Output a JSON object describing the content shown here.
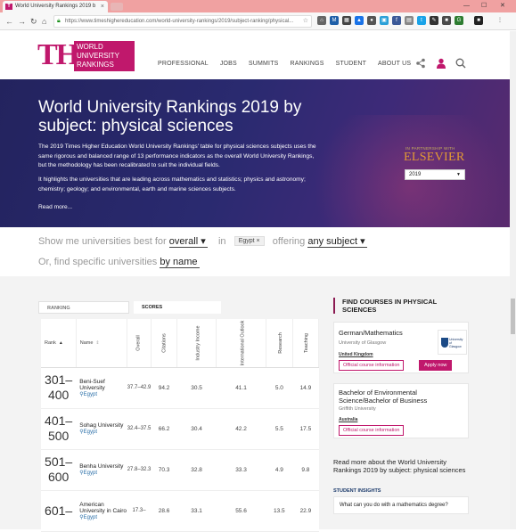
{
  "browser": {
    "tab_title": "World University Rankings 2019 b",
    "tab_close": "×",
    "url": "https://www.timeshighereducation.com/world-university-rankings/2019/subject-ranking/physical...",
    "minimize": "—",
    "maximize": "☐",
    "close": "✕"
  },
  "header": {
    "logo_the": "THE",
    "logo_line1": "WORLD",
    "logo_line2": "UNIVERSITY",
    "logo_line3": "RANKINGS",
    "nav": [
      "PROFESSIONAL",
      "JOBS",
      "SUMMITS",
      "RANKINGS",
      "STUDENT",
      "ABOUT US"
    ]
  },
  "hero": {
    "title": "World University Rankings 2019 by subject: physical sciences",
    "para1": "The 2019 Times Higher Education World University Rankings' table for physical sciences subjects uses the same rigorous and balanced range of 13 performance indicators as the overall World University Rankings, but the methodology has been recalibrated to suit the individual fields.",
    "para2": "It highlights the universities that are leading across mathematics and statistics; physics and astronomy; chemistry; geology; and environmental, earth and marine sciences subjects.",
    "read_more": "Read more...",
    "partner_label": "IN PARTNERSHIP WITH",
    "partner_name": "ELSEVIER",
    "year": "2019"
  },
  "filter": {
    "show_label": "Show me universities best for",
    "best_for": "overall",
    "in_label": "in",
    "country_chip": "Egypt ×",
    "offering_label": "offering",
    "subject": "any subject",
    "find_label": "Or, find specific universities",
    "by_name": "by name"
  },
  "tabs": {
    "ranking": "RANKING",
    "scores": "SCORES"
  },
  "table": {
    "headers": {
      "rank": "Rank",
      "name": "Name",
      "overall": "Overall",
      "citations": "Citations",
      "industry": "Industry Income",
      "international": "International Outlook",
      "research": "Research",
      "teaching": "Teaching"
    },
    "rows": [
      {
        "rank": "301–400",
        "name": "Beni-Suef University",
        "country": "Egypt",
        "overall": "37.7–42.9",
        "citations": "94.2",
        "industry": "30.5",
        "international": "41.1",
        "research": "5.0",
        "teaching": "14.9"
      },
      {
        "rank": "401–500",
        "name": "Sohag University",
        "country": "Egypt",
        "overall": "32.4–37.5",
        "citations": "66.2",
        "industry": "30.4",
        "international": "42.2",
        "research": "5.5",
        "teaching": "17.5"
      },
      {
        "rank": "501–600",
        "name": "Benha University",
        "country": "Egypt",
        "overall": "27.8–32.3",
        "citations": "70.3",
        "industry": "32.8",
        "international": "33.3",
        "research": "4.9",
        "teaching": "9.8"
      },
      {
        "rank": "601–",
        "name": "American University in Cairo",
        "country": "Egypt",
        "overall": "17.3–",
        "citations": "28.6",
        "industry": "33.1",
        "international": "55.6",
        "research": "13.5",
        "teaching": "22.9"
      }
    ]
  },
  "sidebar": {
    "title": "FIND COURSES IN PHYSICAL SCIENCES",
    "course1": {
      "title": "German/Mathematics",
      "university": "University of Glasgow",
      "country": "United Kingdom",
      "btn_info": "Official course information",
      "btn_apply": "Apply now",
      "logo_text": "University of Glasgow"
    },
    "course2": {
      "title": "Bachelor of Environmental Science/Bachelor of Business",
      "university": "Griffith University",
      "country": "Australia",
      "btn_info": "Official course information"
    },
    "more": "Read more about the World University Rankings 2019 by subject: physical sciences",
    "insights_label": "STUDENT INSIGHTS",
    "insight1": "What can you do with a mathematics degree?"
  },
  "colors": {
    "brand": "#c0186c",
    "hero_bg": "#2a2a70",
    "elsevier": "#e39a34"
  }
}
